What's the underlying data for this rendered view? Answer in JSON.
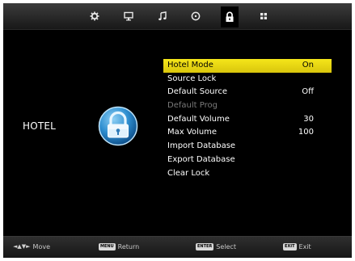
{
  "top_tabs": [
    {
      "icon": "gear-icon",
      "label": ""
    },
    {
      "icon": "monitor-icon",
      "label": ""
    },
    {
      "icon": "music-note-icon",
      "label": ""
    },
    {
      "icon": "clock-icon",
      "label": ""
    },
    {
      "icon": "lock-icon",
      "label": ""
    },
    {
      "icon": "grid-icon",
      "label": ""
    }
  ],
  "active_tab": "lock",
  "menu_title": "HOTEL",
  "menu": {
    "items": [
      {
        "label": "Hotel Mode",
        "value": "On",
        "state": "selected"
      },
      {
        "label": "Source Lock",
        "value": "",
        "state": "normal"
      },
      {
        "label": "Default Source",
        "value": "Off",
        "state": "normal"
      },
      {
        "label": "Default Prog",
        "value": "",
        "state": "disabled"
      },
      {
        "label": "Default Volume",
        "value": "30",
        "state": "normal"
      },
      {
        "label": "Max Volume",
        "value": "100",
        "state": "normal"
      },
      {
        "label": "Import Database",
        "value": "",
        "state": "normal"
      },
      {
        "label": "Export Database",
        "value": "",
        "state": "normal"
      },
      {
        "label": "Clear Lock",
        "value": "",
        "state": "normal"
      }
    ]
  },
  "footer": {
    "move": {
      "key": "◄▲▼►",
      "label": "Move"
    },
    "return": {
      "key": "MENU",
      "label": "Return"
    },
    "select": {
      "key": "ENTER",
      "label": "Select"
    },
    "exit": {
      "key": "EXIT",
      "label": "Exit"
    }
  },
  "colors": {
    "highlight": "#f0df14",
    "background": "#000000",
    "text": "#ffffff",
    "disabled_text": "#7a7a7a",
    "lock_badge": "#2f8fd0"
  }
}
